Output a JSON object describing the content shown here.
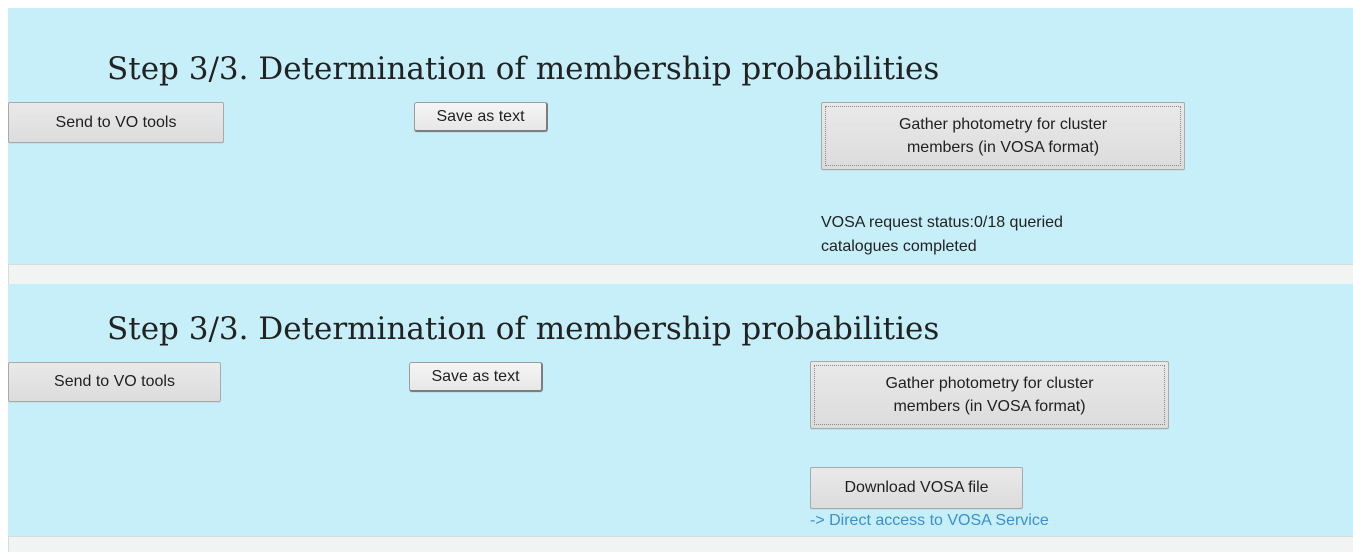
{
  "step_panel_1": {
    "title": "Step 3/3. Determination of membership probabilities",
    "send_vo_label": "Send to VO tools",
    "save_text_label": "Save as text",
    "gather_label": "Gather photometry for cluster members (in VOSA format)",
    "status_text": "VOSA request status:0/18 queried catalogues completed"
  },
  "step_panel_2": {
    "title": "Step 3/3. Determination of membership probabilities",
    "send_vo_label": "Send to VO tools",
    "save_text_label": "Save as text",
    "gather_label": "Gather photometry for cluster members (in VOSA format)",
    "download_label": "Download VOSA file",
    "vosa_link_text": "-> Direct access to VOSA Service"
  },
  "colors": {
    "panel_background": "#c6eff9",
    "separator_background": "#f2f3f3",
    "link": "#3c8fd0"
  }
}
